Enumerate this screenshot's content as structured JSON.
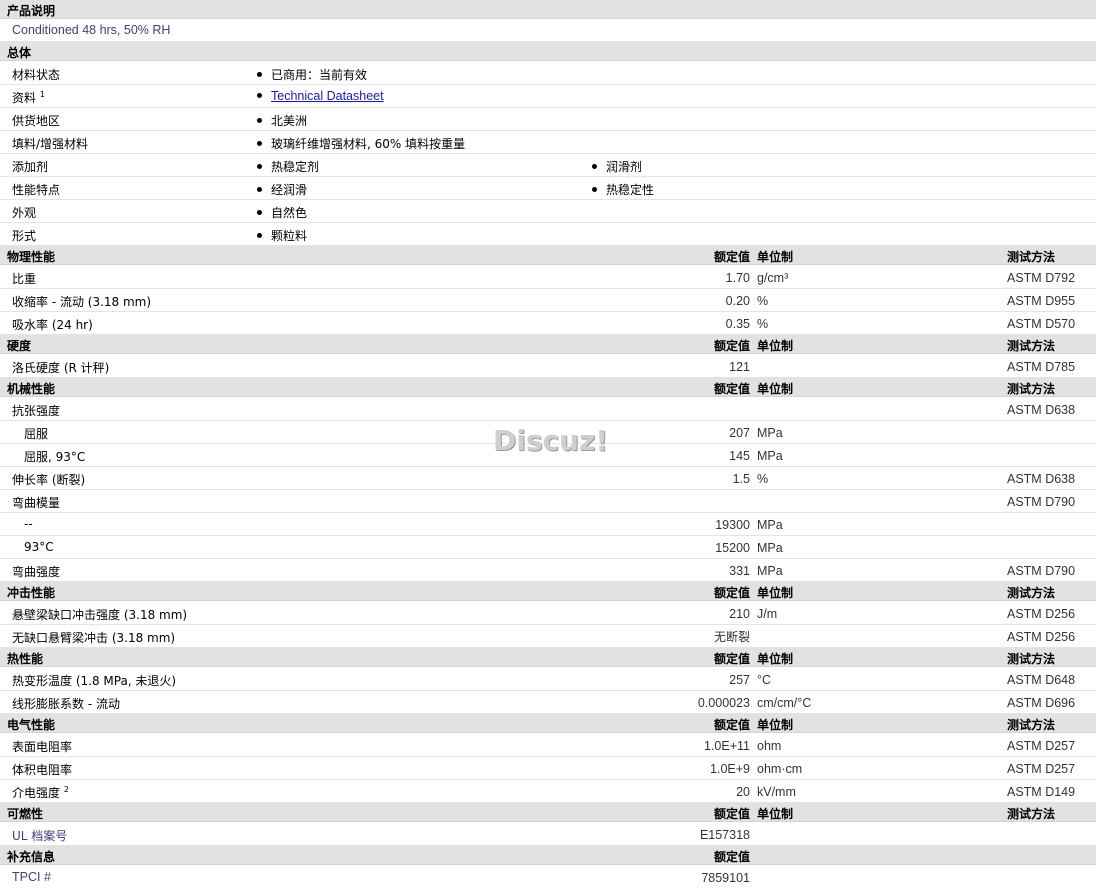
{
  "product_description": {
    "header": "产品说明",
    "text": "Conditioned 48 hrs, 50% RH"
  },
  "general": {
    "header": "总体",
    "rows": [
      {
        "label": "材料状态",
        "items": [
          "已商用：当前有效"
        ]
      },
      {
        "label": "资料",
        "sup": "1",
        "link": "Technical Datasheet"
      },
      {
        "label": "供货地区",
        "items": [
          "北美洲"
        ]
      },
      {
        "label": "填料/增强材料",
        "items": [
          "玻璃纤维增强材料, 60% 填料按重量"
        ]
      },
      {
        "label": "添加剂",
        "items": [
          "热稳定剂",
          "润滑剂"
        ]
      },
      {
        "label": "性能特点",
        "items": [
          "经润滑",
          "热稳定性"
        ]
      },
      {
        "label": "外观",
        "items": [
          "自然色"
        ]
      },
      {
        "label": "形式",
        "items": [
          "颗粒料"
        ]
      }
    ]
  },
  "columns": {
    "rated": "额定值",
    "unit": "单位制",
    "method": "测试方法"
  },
  "physical": {
    "header": "物理性能",
    "rows": [
      {
        "label": "比重",
        "value": "1.70",
        "unit": "g/cm³",
        "method": "ASTM D792"
      },
      {
        "label": "收缩率 - 流动 (3.18 mm)",
        "value": "0.20",
        "unit": "%",
        "method": "ASTM D955"
      },
      {
        "label": "吸水率 (24 hr)",
        "value": "0.35",
        "unit": "%",
        "method": "ASTM D570"
      }
    ]
  },
  "hardness": {
    "header": "硬度",
    "rows": [
      {
        "label": "洛氏硬度 (R 计秤)",
        "value": "121",
        "unit": "",
        "method": "ASTM D785"
      }
    ]
  },
  "mechanical": {
    "header": "机械性能",
    "rows": [
      {
        "label": "抗张强度",
        "value": "",
        "unit": "",
        "method": "ASTM D638"
      },
      {
        "label": "屈服",
        "value": "207",
        "unit": "MPa",
        "method": ""
      },
      {
        "label": "屈服, 93°C",
        "value": "145",
        "unit": "MPa",
        "method": ""
      },
      {
        "label": "伸长率 (断裂)",
        "value": "1.5",
        "unit": "%",
        "method": "ASTM D638"
      },
      {
        "label": "弯曲模量",
        "value": "",
        "unit": "",
        "method": "ASTM D790"
      },
      {
        "label": "--",
        "value": "19300",
        "unit": "MPa",
        "method": ""
      },
      {
        "label": "93°C",
        "value": "15200",
        "unit": "MPa",
        "method": ""
      },
      {
        "label": "弯曲强度",
        "value": "331",
        "unit": "MPa",
        "method": "ASTM D790"
      }
    ]
  },
  "impact": {
    "header": "冲击性能",
    "rows": [
      {
        "label": "悬壁梁缺口冲击强度 (3.18 mm)",
        "value": "210",
        "unit": "J/m",
        "method": "ASTM D256"
      },
      {
        "label": "无缺口悬臂梁冲击 (3.18 mm)",
        "value": "无断裂",
        "unit": "",
        "method": "ASTM D256"
      }
    ]
  },
  "thermal": {
    "header": "热性能",
    "rows": [
      {
        "label": "热变形温度 (1.8 MPa, 未退火)",
        "value": "257",
        "unit": "°C",
        "method": "ASTM D648"
      },
      {
        "label": "线形膨胀系数 - 流动",
        "value": "0.000023",
        "unit": "cm/cm/°C",
        "method": "ASTM D696"
      }
    ]
  },
  "electrical": {
    "header": "电气性能",
    "rows": [
      {
        "label": "表面电阻率",
        "value": "1.0E+11",
        "unit": "ohm",
        "method": "ASTM D257"
      },
      {
        "label": "体积电阻率",
        "value": "1.0E+9",
        "unit": "ohm·cm",
        "method": "ASTM D257"
      },
      {
        "label": "介电强度",
        "sup": "2",
        "value": "20",
        "unit": "kV/mm",
        "method": "ASTM D149"
      }
    ]
  },
  "flammability": {
    "header": "可燃性",
    "rows": [
      {
        "label": "UL 档案号",
        "value": "E157318",
        "unit": "",
        "method": ""
      }
    ]
  },
  "supplemental": {
    "header": "补充信息",
    "rows": [
      {
        "label": "TPCI #",
        "value": "7859101",
        "unit": "",
        "method": ""
      }
    ]
  },
  "watermark": "Discuz!"
}
